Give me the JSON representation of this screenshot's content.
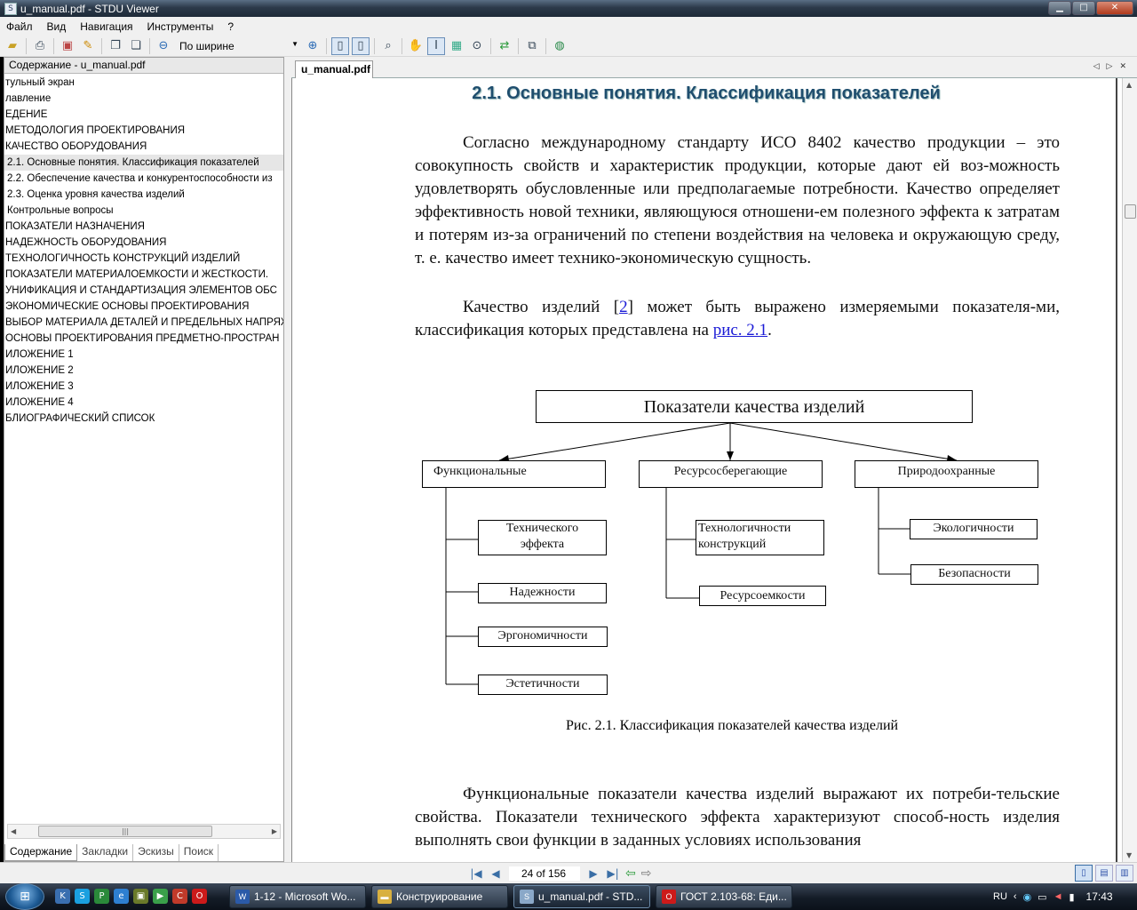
{
  "window": {
    "title": "u_manual.pdf - STDU Viewer",
    "buttons": {
      "minimize": "▁",
      "maximize": "□",
      "close": "✕"
    }
  },
  "menu": {
    "items": [
      {
        "label": "Файл"
      },
      {
        "label": "Вид"
      },
      {
        "label": "Навигация"
      },
      {
        "label": "Инструменты"
      },
      {
        "label": "?"
      }
    ]
  },
  "toolbar": {
    "zoom_value": "По ширине",
    "icons": [
      "open-icon",
      "print-icon",
      "image-export-icon",
      "text-export-icon",
      "copy-icon",
      "paste-icon",
      "zoom-out-icon",
      "zoom-in-icon",
      "single-page-icon",
      "two-page-icon",
      "find-icon",
      "hand-icon",
      "text-select-icon",
      "image-select-icon",
      "magnify-icon",
      "back-forward-icon",
      "copy-pages-icon",
      "globe-icon"
    ]
  },
  "left_panel": {
    "header": "Содержание - u_manual.pdf",
    "toc": [
      {
        "label": "тульный экран"
      },
      {
        "label": "лавление"
      },
      {
        "label": "ЕДЕНИЕ"
      },
      {
        "label": "МЕТОДОЛОГИЯ  ПРОЕКТИРОВАНИЯ"
      },
      {
        "label": "КАЧЕСТВО  ОБОРУДОВАНИЯ"
      },
      {
        "label": " 2.1. Основные понятия. Классификация показателей",
        "selected": true
      },
      {
        "label": " 2.2. Обеспечение качества и конкурентоспособности из"
      },
      {
        "label": " 2.3. Оценка уровня качества изделий"
      },
      {
        "label": " Контрольные вопросы"
      },
      {
        "label": "ПОКАЗАТЕЛИ  НАЗНАЧЕНИЯ"
      },
      {
        "label": "НАДЕЖНОСТЬ  ОБОРУДОВАНИЯ"
      },
      {
        "label": "ТЕХНОЛОГИЧНОСТЬ  КОНСТРУКЦИЙ  ИЗДЕЛИЙ"
      },
      {
        "label": "ПОКАЗАТЕЛИ  МАТЕРИАЛОЕМКОСТИ  И  ЖЕСТКОСТИ."
      },
      {
        "label": "УНИФИКАЦИЯ  И  СТАНДАРТИЗАЦИЯ ЭЛЕМЕНТОВ  ОБС"
      },
      {
        "label": "ЭКОНОМИЧЕСКИЕ  ОСНОВЫ  ПРОЕКТИРОВАНИЯ"
      },
      {
        "label": "ВЫБОР  МАТЕРИАЛА  ДЕТАЛЕЙ И  ПРЕДЕЛЬНЫХ  НАПРЯЖ"
      },
      {
        "label": " ОСНОВЫ  ПРОЕКТИРОВАНИЯ ПРЕДМЕТНО-ПРОСТРАН"
      },
      {
        "label": "ИЛОЖЕНИЕ 1"
      },
      {
        "label": "ИЛОЖЕНИЕ 2"
      },
      {
        "label": "ИЛОЖЕНИЕ 3"
      },
      {
        "label": "ИЛОЖЕНИЕ 4"
      },
      {
        "label": "БЛИОГРАФИЧЕСКИЙ  СПИСОК"
      }
    ],
    "tabs": [
      "Содержание",
      "Закладки",
      "Эскизы",
      "Поиск"
    ]
  },
  "document": {
    "tab_label": "u_manual.pdf",
    "heading": "2.1. Основные понятия. Классификация показателей",
    "para1": "Согласно международному стандарту ИСО 8402 качество продукции – это совокупность свойств и характеристик продукции, которые дают ей воз-можность удовлетворять обусловленные или предполагаемые потребности. Качество определяет эффективность новой техники, являющуюся отношени-ем полезного эффекта к затратам и потерям из-за ограничений по степени воздействия на человека и окружающую среду, т. е. качество имеет технико-экономическую сущность.",
    "para2_a": "Качество изделий [",
    "para2_link1": "2",
    "para2_b": "] может быть выражено измеряемыми показателя-ми, классификация которых представлена на ",
    "para2_link2": "рис. 2.1",
    "para2_c": ".",
    "diagram": {
      "root": "Показатели качества изделий",
      "groups": [
        {
          "label": "Функциональные",
          "children": [
            "Технического эффекта",
            "Надежности",
            "Эргономичности",
            "Эстетичности"
          ]
        },
        {
          "label": "Ресурсосберегающие",
          "children": [
            "Технологичности конструкций",
            "Ресурсоемкости"
          ]
        },
        {
          "label": "Природоохранные",
          "children": [
            "Экологичности",
            "Безопасности"
          ]
        }
      ]
    },
    "caption": "Рис. 2.1. Классификация показателей качества изделий",
    "para3": "Функциональные показатели качества изделий выражают их потреби-тельские свойства. Показатели технического эффекта характеризуют способ-ность изделия выполнять свои функции в заданных условиях использования"
  },
  "status": {
    "page_indicator": "24 of 156"
  },
  "taskbar": {
    "start": "⊞",
    "buttons": [
      {
        "label": "1-12 - Microsoft Wo...",
        "icon": "word-icon"
      },
      {
        "label": "Конструирование",
        "icon": "folder-icon"
      },
      {
        "label": "u_manual.pdf - STD...",
        "icon": "stdu-icon",
        "active": true
      },
      {
        "label": "ГОСТ 2.103-68: Еди...",
        "icon": "opera-icon"
      }
    ],
    "lang": "RU",
    "clock": "17:43"
  }
}
